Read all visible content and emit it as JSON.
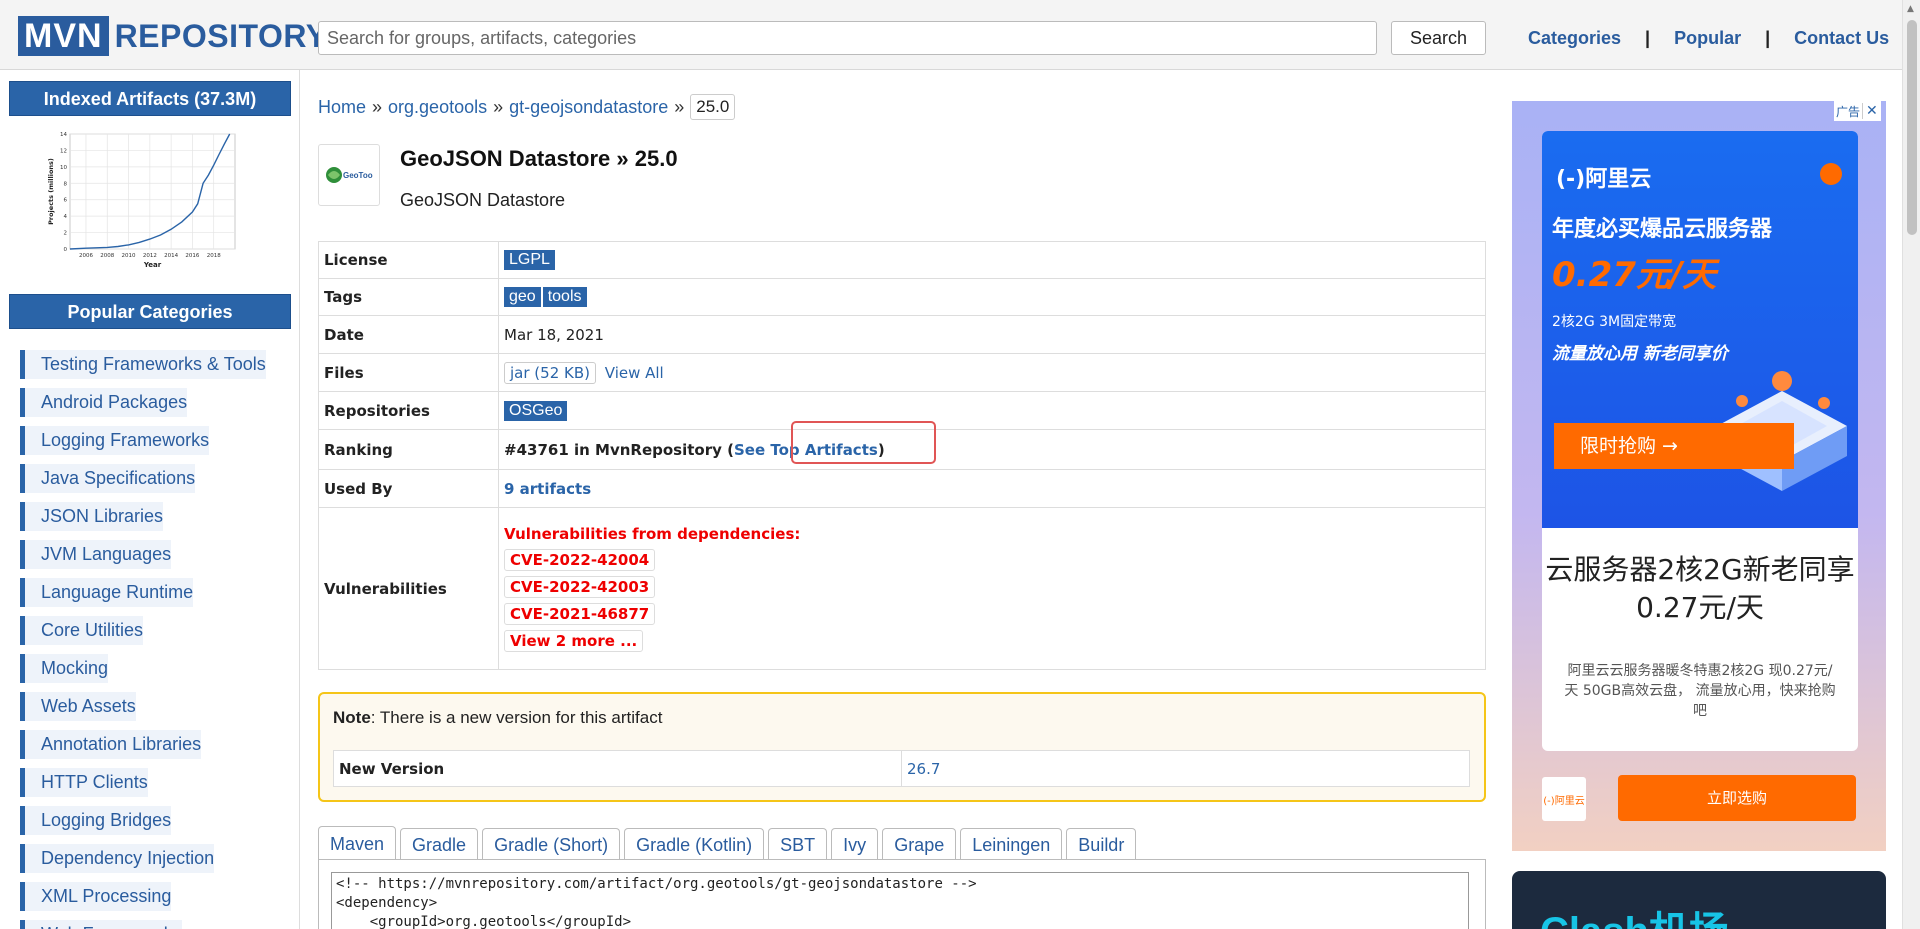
{
  "header": {
    "logo_left": "MVN",
    "logo_right": "REPOSITORY",
    "search_placeholder": "Search for groups, artifacts, categories",
    "search_button": "Search",
    "nav": [
      "Categories",
      "Popular",
      "Contact Us"
    ],
    "nav_separator": "|"
  },
  "sidebar": {
    "indexed_title": "Indexed Artifacts (37.3M)",
    "chart_ylabel": "Projects (millions)",
    "chart_xlabel": "Year",
    "categories_title": "Popular Categories",
    "categories": [
      "Testing Frameworks & Tools",
      "Android Packages",
      "Logging Frameworks",
      "Java Specifications",
      "JSON Libraries",
      "JVM Languages",
      "Language Runtime",
      "Core Utilities",
      "Mocking",
      "Web Assets",
      "Annotation Libraries",
      "HTTP Clients",
      "Logging Bridges",
      "Dependency Injection",
      "XML Processing",
      "Web Frameworks"
    ]
  },
  "chart_data": {
    "type": "line",
    "title": "",
    "xlabel": "Year",
    "ylabel": "Projects (millions)",
    "x_ticks": [
      "2006",
      "2008",
      "2010",
      "2012",
      "2014",
      "2016",
      "2018"
    ],
    "y_ticks": [
      "0",
      "2",
      "4",
      "6",
      "8",
      "10",
      "12",
      "14"
    ],
    "xlim": [
      2004.5,
      2020
    ],
    "ylim": [
      0,
      14
    ],
    "grid": true,
    "series": [
      {
        "x": [
          2004.5,
          2006,
          2008,
          2009,
          2010,
          2011,
          2012,
          2013,
          2014,
          2015,
          2016,
          2016.5,
          2017,
          2017.5,
          2018,
          2018.5,
          2019,
          2019.5
        ],
        "y": [
          0,
          0.1,
          0.2,
          0.3,
          0.5,
          0.8,
          1.2,
          1.7,
          2.4,
          3.3,
          4.5,
          5.5,
          8.0,
          9.0,
          10.2,
          11.5,
          12.8,
          14.0
        ]
      }
    ]
  },
  "breadcrumb": {
    "home": "Home",
    "group": "org.geotools",
    "artifact": "gt-geojsondatastore",
    "version": "25.0",
    "sep": "»"
  },
  "artifact": {
    "logo_text": "GeoTools",
    "title": "GeoJSON Datastore » 25.0",
    "description": "GeoJSON Datastore"
  },
  "info": {
    "license_label": "License",
    "license_value": "LGPL",
    "tags_label": "Tags",
    "tags": [
      "geo",
      "tools"
    ],
    "date_label": "Date",
    "date_value": "Mar 18, 2021",
    "files_label": "Files",
    "files_jar": "jar (52 KB)",
    "files_view_all": "View All",
    "repos_label": "Repositories",
    "repos_value": "OSGeo",
    "ranking_label": "Ranking",
    "ranking_prefix": "#43761 in MvnRepository (",
    "ranking_link": "See Top Artifacts",
    "ranking_suffix": ")",
    "usedby_label": "Used By",
    "usedby_value": "9 artifacts",
    "vuln_label": "Vulnerabilities",
    "vuln_head": "Vulnerabilities from dependencies:",
    "cves": [
      "CVE-2022-42004",
      "CVE-2022-42003",
      "CVE-2021-46877"
    ],
    "vuln_more": "View 2 more ..."
  },
  "note": {
    "bold": "Note",
    "text": ": There is a new version for this artifact",
    "new_version_label": "New Version",
    "new_version_value": "26.7"
  },
  "tabs": [
    "Maven",
    "Gradle",
    "Gradle (Short)",
    "Gradle (Kotlin)",
    "SBT",
    "Ivy",
    "Grape",
    "Leiningen",
    "Buildr"
  ],
  "code": "<!-- https://mvnrepository.com/artifact/org.geotools/gt-geojsondatastore -->\n<dependency>\n    <groupId>org.geotools</groupId>",
  "ad": {
    "badge": "广告",
    "close": "✕",
    "brand": "(-)阿里云",
    "headline": "年度必买爆品云服务器",
    "price": "0.27元/天",
    "spec": "2核2G 3M固定带宽",
    "slogan": "流量放心用  新老同享价",
    "cta": "限时抢购    →",
    "title2": "云服务器2核2G新老同享0.27元/天",
    "body": "阿里云云服务器暖冬特惠2核2G 现0.27元/天 50GB高效云盘， 流量放心用，快来抢购吧",
    "mini_logo": "(-)阿里云",
    "buy": "立即选购",
    "ad2_text": "Clash机场"
  },
  "colors": {
    "brand_blue": "#2a64a8",
    "alert_red": "#e00000",
    "note_border": "#f5c518",
    "ad_orange": "#ff6a00"
  }
}
